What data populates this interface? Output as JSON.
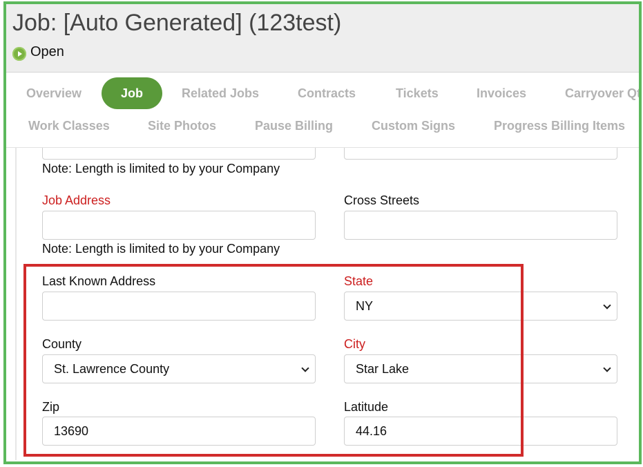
{
  "header": {
    "title": "Job: [Auto Generated] (123test)",
    "status": "Open"
  },
  "tabs": [
    {
      "label": "Overview"
    },
    {
      "label": "Job"
    },
    {
      "label": "Related Jobs"
    },
    {
      "label": "Contracts"
    },
    {
      "label": "Tickets"
    },
    {
      "label": "Invoices"
    },
    {
      "label": "Carryover Qty"
    },
    {
      "label": "Work Classes"
    },
    {
      "label": "Site Photos"
    },
    {
      "label": "Pause Billing"
    },
    {
      "label": "Custom Signs"
    },
    {
      "label": "Progress Billing Items"
    }
  ],
  "form": {
    "note": "Note: Length is limited to by your Company",
    "job_address": {
      "label": "Job Address",
      "value": ""
    },
    "cross_streets": {
      "label": "Cross Streets",
      "value": ""
    },
    "last_known_address": {
      "label": "Last Known Address",
      "value": ""
    },
    "state": {
      "label": "State",
      "value": "NY"
    },
    "county": {
      "label": "County",
      "value": "St. Lawrence County"
    },
    "city": {
      "label": "City",
      "value": "Star Lake"
    },
    "zip": {
      "label": "Zip",
      "value": "13690"
    },
    "latitude": {
      "label": "Latitude",
      "value": "44.16"
    }
  },
  "colors": {
    "accent": "#5a9a3a",
    "frame": "#5cb85c",
    "highlight": "#d12b2b",
    "required": "#cc1f1f"
  }
}
